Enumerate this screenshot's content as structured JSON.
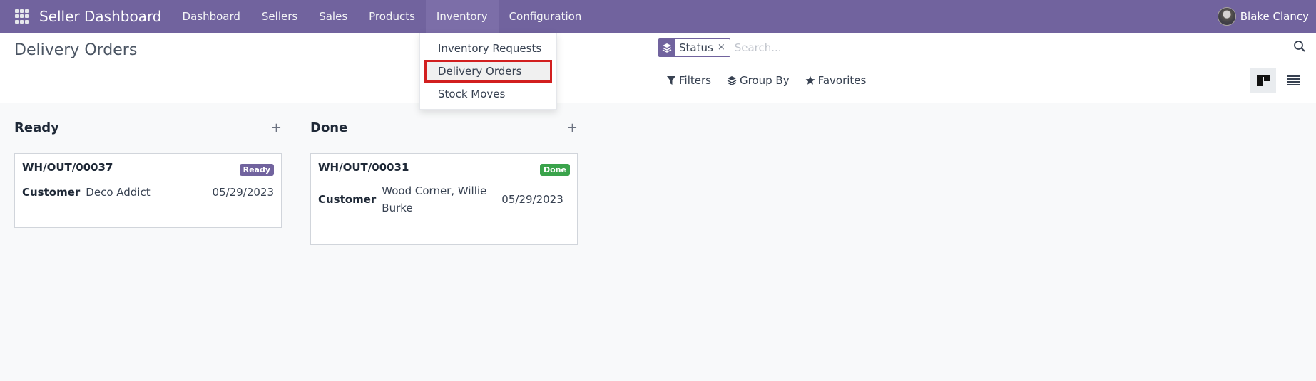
{
  "navbar": {
    "brand": "Seller Dashboard",
    "items": [
      {
        "label": "Dashboard"
      },
      {
        "label": "Sellers"
      },
      {
        "label": "Sales"
      },
      {
        "label": "Products"
      },
      {
        "label": "Inventory",
        "active": true
      },
      {
        "label": "Configuration"
      }
    ],
    "user": "Blake Clancy"
  },
  "dropdown": {
    "items": [
      {
        "label": "Inventory Requests"
      },
      {
        "label": "Delivery Orders",
        "highlighted": true
      },
      {
        "label": "Stock Moves"
      }
    ]
  },
  "control": {
    "title": "Delivery Orders",
    "facet_label": "Status",
    "facet_close": "×",
    "search_placeholder": "Search...",
    "filters_label": "Filters",
    "groupby_label": "Group By",
    "favorites_label": "Favorites"
  },
  "kanban": {
    "columns": [
      {
        "title": "Ready",
        "add": "+",
        "cards": [
          {
            "ref": "WH/OUT/00037",
            "badge": "Ready",
            "badge_color": "#71639e",
            "customer_label": "Customer",
            "customer": "Deco Addict",
            "date": "05/29/2023"
          }
        ]
      },
      {
        "title": "Done",
        "add": "+",
        "cards": [
          {
            "ref": "WH/OUT/00031",
            "badge": "Done",
            "badge_color": "#3aa34b",
            "customer_label": "Customer",
            "customer": "Wood Corner, Willie Burke",
            "date": "05/29/2023"
          }
        ]
      }
    ]
  },
  "colors": {
    "brand": "#71639e",
    "highlight_box": "#d21f1f"
  }
}
